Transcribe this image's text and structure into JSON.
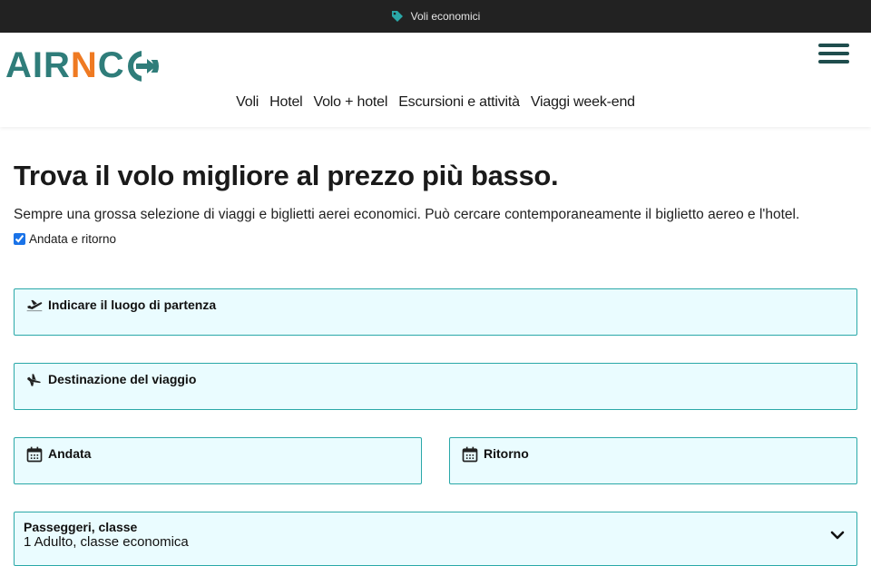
{
  "topbar": {
    "label": "Voli economici",
    "icon": "tag-icon"
  },
  "logo": {
    "part1": "AIR",
    "part2": "N",
    "part3": "C",
    "icon": "arrow-circle-icon"
  },
  "nav": {
    "items": [
      "Voli",
      "Hotel",
      "Volo + hotel",
      "Escursioni e attività",
      "Viaggi week-end"
    ]
  },
  "main": {
    "title": "Trova il volo migliore al prezzo più basso.",
    "description": "Sempre una grossa selezione di viaggi e biglietti aerei economici. Può cercare contemporaneamente il biglietto aereo e l'hotel.",
    "roundtrip_label": "Andata e ritorno",
    "roundtrip_checked": true
  },
  "form": {
    "departure_label": "Indicare il luogo di partenza",
    "destination_label": "Destinazione del viaggio",
    "outbound_label": "Andata",
    "return_label": "Ritorno",
    "passengers_label": "Passeggeri, classe",
    "passengers_value": "1 Adulto, classe economica"
  },
  "colors": {
    "accent": "#2f7d7a",
    "brand_orange": "#ef7a22",
    "field_bg": "#eafcff",
    "field_border": "#2aa8a8",
    "topbar_bg": "#222222"
  }
}
